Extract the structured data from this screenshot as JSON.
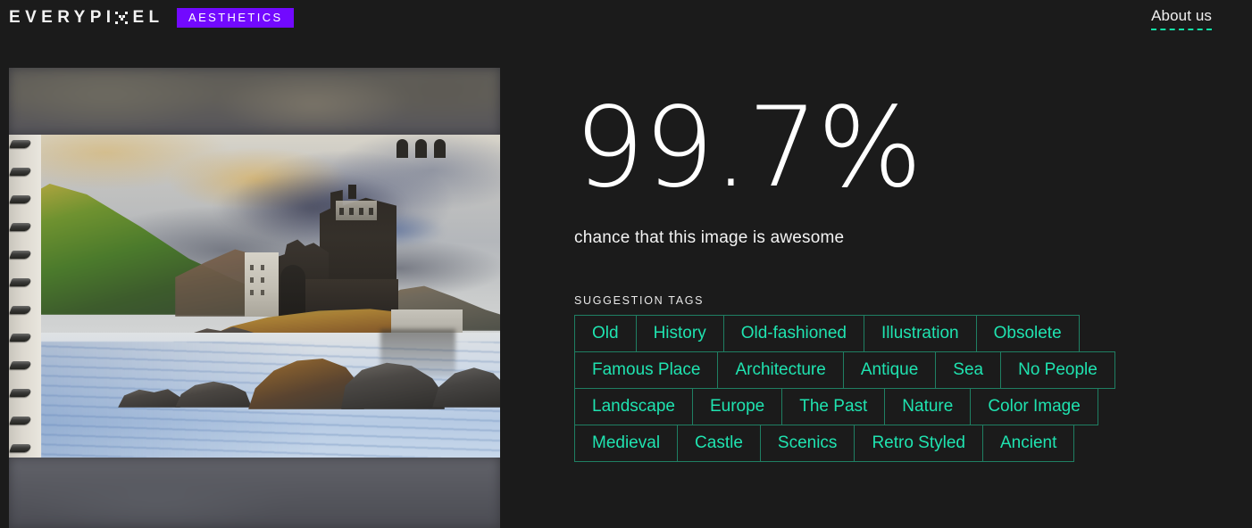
{
  "header": {
    "brand_prefix": "EVERYPI",
    "brand_suffix": "EL",
    "brand_icon": "pixel-x-icon",
    "badge_label": "AESTHETICS",
    "about_label": "About us",
    "badge_color": "#7209ff",
    "accent_color": "#1fe3b0"
  },
  "image_panel": {
    "alt": "watercolor painting of a castle by a loch in a spiral sketchbook"
  },
  "result": {
    "score": "99.7%",
    "caption": "chance that this image is awesome"
  },
  "tags_section": {
    "heading": "SUGGESTION TAGS",
    "rows": [
      [
        "Old",
        "History",
        "Old-fashioned",
        "Illustration",
        "Obsolete"
      ],
      [
        "Famous Place",
        "Architecture",
        "Antique",
        "Sea",
        "No People"
      ],
      [
        "Landscape",
        "Europe",
        "The Past",
        "Nature",
        "Color Image"
      ],
      [
        "Medieval",
        "Castle",
        "Scenics",
        "Retro Styled",
        "Ancient"
      ]
    ]
  }
}
